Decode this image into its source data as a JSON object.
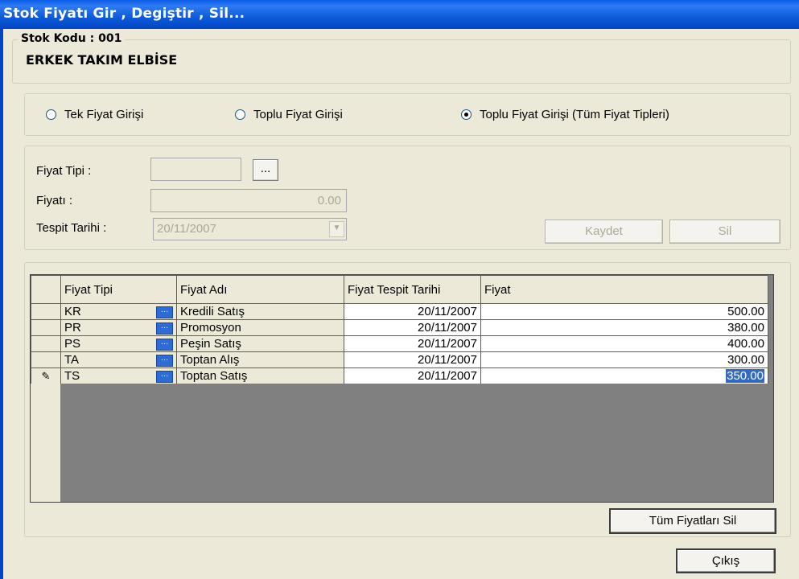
{
  "window": {
    "title": "Stok Fiyatı Gir , Degiştir , Sil..."
  },
  "stock": {
    "legend": "Stok Kodu : 001",
    "name": "ERKEK TAKIM ELBİSE"
  },
  "entry_mode": {
    "options": [
      {
        "label": "Tek Fiyat Girişi",
        "selected": false
      },
      {
        "label": "Toplu Fiyat Girişi",
        "selected": false
      },
      {
        "label": "Toplu Fiyat Girişi (Tüm Fiyat Tipleri)",
        "selected": true
      }
    ]
  },
  "form": {
    "price_type_label": "Fiyat Tipi :",
    "price_type_value": "",
    "browse_label": "...",
    "price_label": "Fiyatı :",
    "price_value": "0.00",
    "date_label": "Tespit Tarihi :",
    "date_value": "20/11/2007",
    "save_label": "Kaydet",
    "delete_label": "Sil"
  },
  "grid": {
    "columns": [
      "Fiyat Tipi",
      "Fiyat Adı",
      "Fiyat Tespit Tarihi",
      "Fiyat"
    ],
    "rows": [
      {
        "code": "KR",
        "name": "Kredili Satış",
        "date": "20/11/2007",
        "price": "500.00"
      },
      {
        "code": "PR",
        "name": "Promosyon",
        "date": "20/11/2007",
        "price": "380.00"
      },
      {
        "code": "PS",
        "name": "Peşin Satış",
        "date": "20/11/2007",
        "price": "400.00"
      },
      {
        "code": "TA",
        "name": "Toptan Alış",
        "date": "20/11/2007",
        "price": "300.00"
      },
      {
        "code": "TS",
        "name": "Toptan Satış",
        "date": "20/11/2007",
        "price": "350.00"
      }
    ],
    "row_button": "...",
    "edit_indicator": "pencil-icon"
  },
  "actions": {
    "delete_all_label": "Tüm Fiyatları Sil",
    "exit_label": "Çıkış"
  }
}
